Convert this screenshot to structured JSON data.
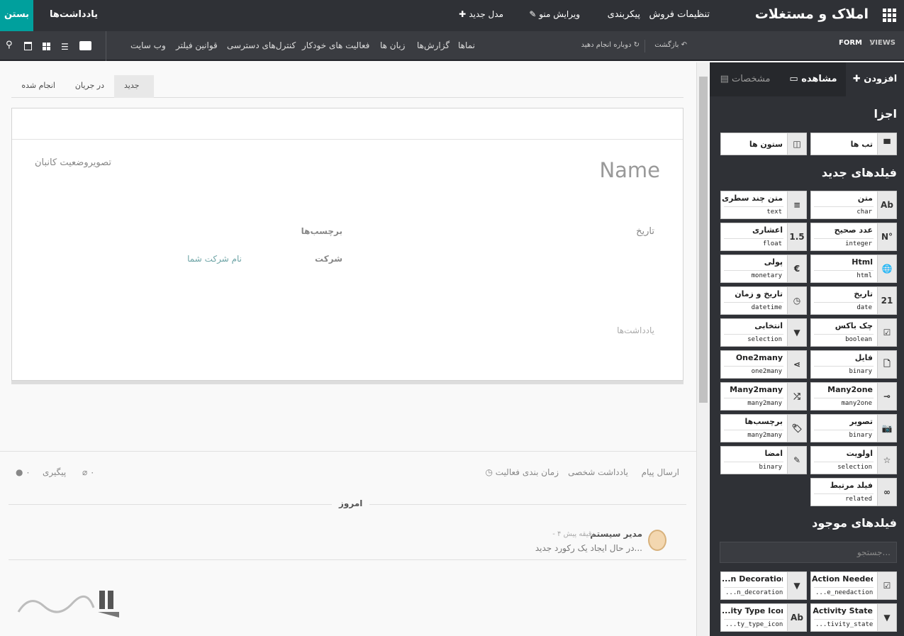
{
  "app": {
    "title": "املاک و مستغلات",
    "menu": [
      "تنظیمات فروش",
      "پیکربندی"
    ],
    "edit_menu": "ویرایش منو",
    "new_model": "مدل جدید",
    "notes": "یادداشت‌ها",
    "close": "بستن"
  },
  "subbar": {
    "breadcrumb": [
      "VIEWS",
      "FORM"
    ],
    "back": "بازگشت",
    "redo": "دوباره انجام دهید",
    "items": [
      "نماها",
      "گزارش‌ها",
      "زبان ها",
      "فعالیت های خودکار",
      "کنترل‌های دسترسی",
      "قوانین فیلتر",
      "وب سایت"
    ]
  },
  "form": {
    "stages": [
      "جدید",
      "در جریان",
      "انجام شده"
    ],
    "name_placeholder": "Name",
    "kanban_state": "تصویروضعیت کانبان",
    "date_label": "تاریخ",
    "tags_label": "برچسب‌ها",
    "company_label": "شرکت",
    "company_value": "نام شرکت شما",
    "notes_label": "یادداشت‌ها"
  },
  "chatter": {
    "send_message": "ارسال پیام",
    "log_note": "یادداشت شخصی",
    "schedule": "زمان بندی فعالیت",
    "attachments": "۰",
    "follow": "پیگیری",
    "followers": "۰",
    "today": "امروز",
    "author": "مدیر سیستم",
    "time": "- ۴ دقیقه پیش",
    "message": "در حال ایجاد یک رکورد جدید..."
  },
  "sidebar": {
    "tabs": [
      "افزودن",
      "مشاهده",
      "مشخصات"
    ],
    "components_title": "اجزا",
    "components": [
      {
        "label": "تب ها",
        "icon": "tabs-icon"
      },
      {
        "label": "ستون ها",
        "icon": "columns-icon"
      }
    ],
    "new_fields_title": "فیلدهای جدید",
    "new_fields": [
      {
        "label": "متن",
        "type": "char",
        "icon": "Ab"
      },
      {
        "label": "متن چند سطری",
        "type": "text",
        "icon": "≡"
      },
      {
        "label": "عدد صحیح",
        "type": "integer",
        "icon": "N°"
      },
      {
        "label": "اعشاری",
        "type": "float",
        "icon": "1.5"
      },
      {
        "label": "Html",
        "type": "html",
        "icon": "🌐"
      },
      {
        "label": "پولی",
        "type": "monetary",
        "icon": "€"
      },
      {
        "label": "تاریخ",
        "type": "date",
        "icon": "21"
      },
      {
        "label": "تاریخ و زمان",
        "type": "datetime",
        "icon": "◷"
      },
      {
        "label": "چک باکس",
        "type": "boolean",
        "icon": "☑"
      },
      {
        "label": "انتخابی",
        "type": "selection",
        "icon": "▼"
      },
      {
        "label": "فایل",
        "type": "binary",
        "icon": "🗋"
      },
      {
        "label": "One2many",
        "type": "one2many",
        "icon": "⋖"
      },
      {
        "label": "Many2one",
        "type": "many2one",
        "icon": "⊸"
      },
      {
        "label": "Many2many",
        "type": "many2many",
        "icon": "⤮"
      },
      {
        "label": "تصویر",
        "type": "binary",
        "icon": "📷"
      },
      {
        "label": "برچسب‌ها",
        "type": "many2many",
        "icon": "🏷"
      },
      {
        "label": "اولویت",
        "type": "selection",
        "icon": "☆"
      },
      {
        "label": "امضا",
        "type": "binary",
        "icon": "✎"
      },
      {
        "label": "فیلد مرتبط",
        "type": "related",
        "icon": "∞"
      }
    ],
    "existing_title": "فیلدهای موجود",
    "search_placeholder": "جستجو...",
    "existing": [
      {
        "label": "Action Needed",
        "type": "...e_needaction",
        "icon": "☑"
      },
      {
        "label": "...n Decoration",
        "type": "...n_decoration",
        "icon": "▼"
      },
      {
        "label": "Activity State",
        "type": "...tivity_state",
        "icon": "▼"
      },
      {
        "label": "...ity Type Icon",
        "type": "...ty_type_icon",
        "icon": "Ab"
      }
    ]
  }
}
